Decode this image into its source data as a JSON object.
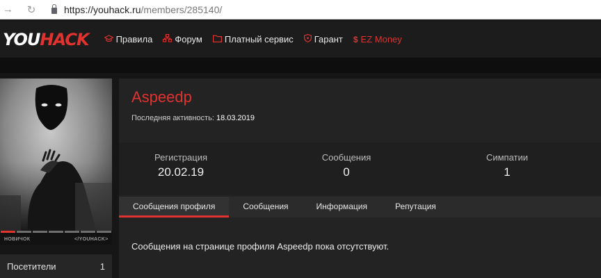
{
  "browser": {
    "url_host": "https://youhack.ru",
    "url_path": "/members/285140/"
  },
  "site": {
    "logo_you": "YOU",
    "logo_hack": "HACK",
    "accent": "#e0322f"
  },
  "nav": {
    "items": [
      {
        "label": "Правила",
        "icon": "graduation-cap-icon"
      },
      {
        "label": "Форум",
        "icon": "sitemap-icon"
      },
      {
        "label": "Платный сервис",
        "icon": "folder-icon"
      },
      {
        "label": "Гарант",
        "icon": "shield-icon"
      },
      {
        "label": "EZ Money",
        "icon": "dollar-icon"
      }
    ]
  },
  "profile": {
    "username": "Aspeedp",
    "last_activity_label": "Последняя активность:",
    "last_activity_value": "18.03.2019",
    "rank_left": "НОВИЧОК",
    "rank_right": "</YOUHACK>",
    "rank_progress_segments_filled": 1,
    "rank_progress_segments_total": 7,
    "stats": [
      {
        "label": "Регистрация",
        "value": "20.02.19"
      },
      {
        "label": "Сообщения",
        "value": "0"
      },
      {
        "label": "Симпатии",
        "value": "1"
      }
    ]
  },
  "tabs": [
    {
      "label": "Сообщения профиля",
      "active": true
    },
    {
      "label": "Сообщения",
      "active": false
    },
    {
      "label": "Информация",
      "active": false
    },
    {
      "label": "Репутация",
      "active": false
    }
  ],
  "content": {
    "empty_message": "Сообщения на странице профиля Aspeedp пока отсутствуют."
  },
  "sidebar": {
    "visitors_label": "Посетители",
    "visitors_count": "1"
  }
}
